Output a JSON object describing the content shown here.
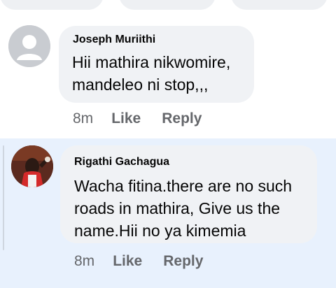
{
  "comments": [
    {
      "author": "Joseph Muriithi",
      "text": "Hii mathira nikwomire, mandeleo ni stop,,,",
      "time": "8m",
      "like_label": "Like",
      "reply_label": "Reply",
      "avatar_icon": "default-profile-icon"
    },
    {
      "author": "Rigathi Gachagua",
      "text": "Wacha fitina.there are no such roads in mathira, Give us the name.Hii no ya kimemia",
      "time": "8m",
      "like_label": "Like",
      "reply_label": "Reply",
      "avatar_icon": "profile-photo"
    }
  ],
  "colors": {
    "bubble": "#f0f2f5",
    "highlight_bg": "#e8f1fd",
    "meta_text": "#65676b",
    "text": "#050505"
  }
}
